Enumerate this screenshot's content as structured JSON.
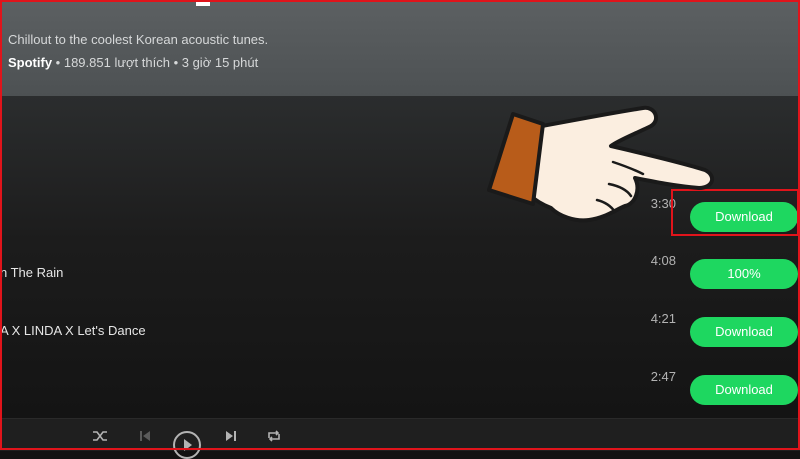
{
  "playlist": {
    "description": "Chillout to the coolest Korean acoustic tunes.",
    "owner": "Spotify",
    "info": " • 189.851 lượt thích • 3 giờ 15 phút"
  },
  "tracks": [
    {
      "title": "",
      "duration": "3:30",
      "action": "Download"
    },
    {
      "title": "n The Rain",
      "duration": "4:08",
      "action": "100%"
    },
    {
      "title": "A X LINDA X Let's Dance",
      "duration": "4:21",
      "action": "Download"
    },
    {
      "title": "",
      "duration": "2:47",
      "action": "Download"
    }
  ],
  "player": {
    "controls": [
      "shuffle-icon",
      "previous-icon",
      "play-icon",
      "next-icon",
      "repeat-icon"
    ]
  },
  "colors": {
    "accent": "#1ed760",
    "highlight": "#e0141b",
    "hand_fill": "#fbeee0",
    "cuff": "#b85c1a"
  }
}
